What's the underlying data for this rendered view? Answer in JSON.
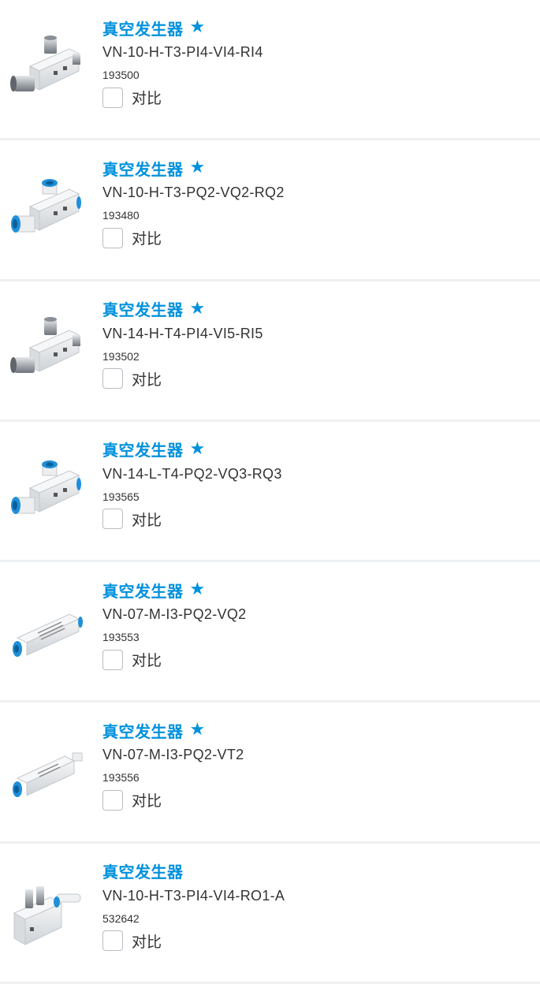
{
  "colors": {
    "accent": "#0091dc",
    "fitting_blue": "#1f8fd9"
  },
  "compare_label": "对比",
  "products": [
    {
      "title": "真空发生器",
      "starred": true,
      "model": "VN-10-H-T3-PI4-VI4-RI4",
      "part_no": "193500",
      "image": "vacuum-generator-metal-fitting-icon"
    },
    {
      "title": "真空发生器",
      "starred": true,
      "model": "VN-10-H-T3-PQ2-VQ2-RQ2",
      "part_no": "193480",
      "image": "vacuum-generator-blue-push-in-icon"
    },
    {
      "title": "真空发生器",
      "starred": true,
      "model": "VN-14-H-T4-PI4-VI5-RI5",
      "part_no": "193502",
      "image": "vacuum-generator-metal-fitting-icon"
    },
    {
      "title": "真空发生器",
      "starred": true,
      "model": "VN-14-L-T4-PQ2-VQ3-RQ3",
      "part_no": "193565",
      "image": "vacuum-generator-blue-push-in-icon"
    },
    {
      "title": "真空发生器",
      "starred": true,
      "model": "VN-07-M-I3-PQ2-VQ2",
      "part_no": "193553",
      "image": "inline-vacuum-generator-icon"
    },
    {
      "title": "真空发生器",
      "starred": true,
      "model": "VN-07-M-I3-PQ2-VT2",
      "part_no": "193556",
      "image": "inline-vacuum-generator-tube-icon"
    },
    {
      "title": "真空发生器",
      "starred": false,
      "model": "VN-10-H-T3-PI4-VI4-RO1-A",
      "part_no": "532642",
      "image": "vacuum-generator-manifold-icon"
    }
  ]
}
